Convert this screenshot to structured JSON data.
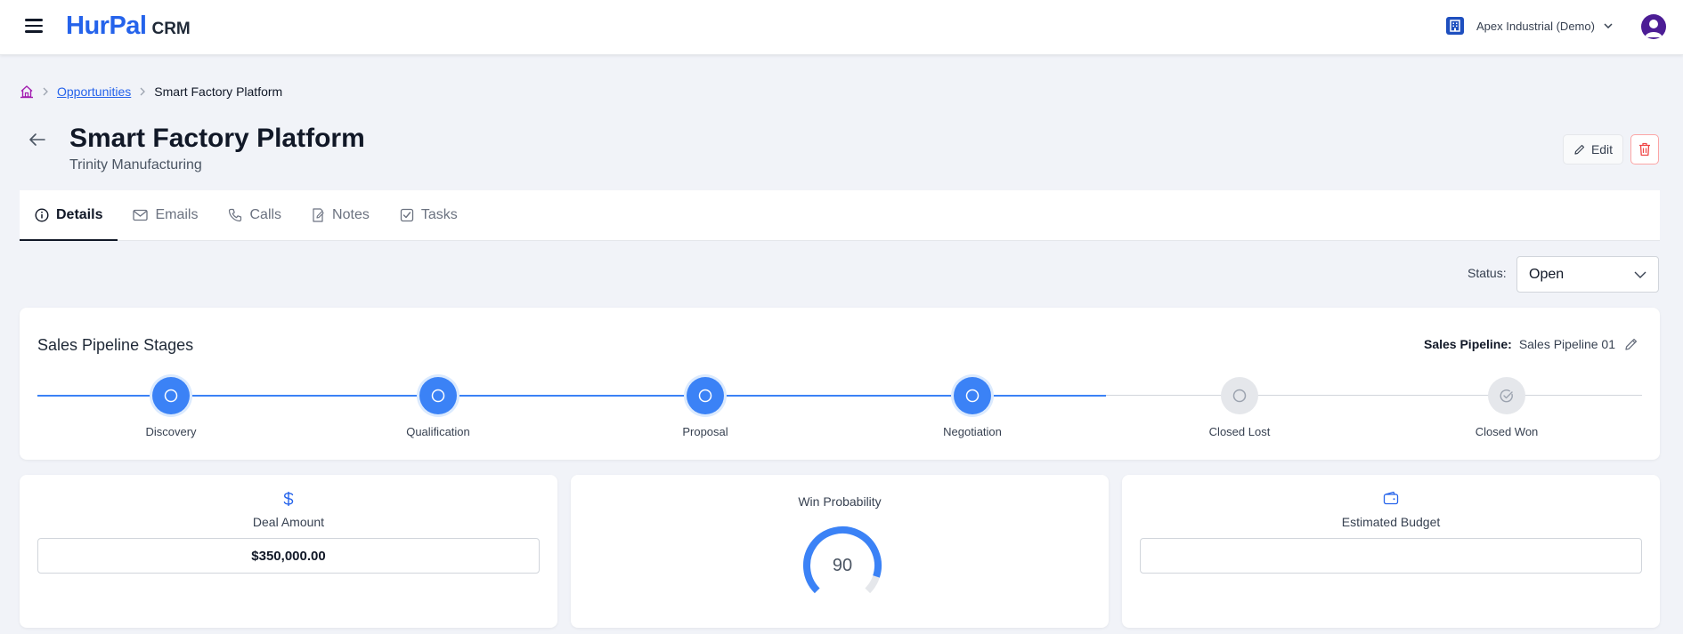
{
  "app": {
    "brand_main": "HurPal",
    "brand_sub": "CRM"
  },
  "header": {
    "org_name": "Apex Industrial (Demo)"
  },
  "breadcrumb": {
    "link": "Opportunities",
    "current": "Smart Factory Platform"
  },
  "page": {
    "title": "Smart Factory Platform",
    "subtitle": "Trinity Manufacturing",
    "edit_label": "Edit"
  },
  "tabs": [
    {
      "label": "Details",
      "icon": "info-icon",
      "active": true
    },
    {
      "label": "Emails",
      "icon": "mail-icon",
      "active": false
    },
    {
      "label": "Calls",
      "icon": "phone-icon",
      "active": false
    },
    {
      "label": "Notes",
      "icon": "note-icon",
      "active": false
    },
    {
      "label": "Tasks",
      "icon": "checkbox-icon",
      "active": false
    }
  ],
  "status": {
    "label": "Status:",
    "value": "Open"
  },
  "pipeline": {
    "title": "Sales Pipeline Stages",
    "pipeline_label": "Sales Pipeline:",
    "pipeline_value": "Sales Pipeline 01",
    "stages": [
      {
        "label": "Discovery",
        "done": true
      },
      {
        "label": "Qualification",
        "done": true
      },
      {
        "label": "Proposal",
        "done": true
      },
      {
        "label": "Negotiation",
        "done": true
      },
      {
        "label": "Closed Lost",
        "done": false
      },
      {
        "label": "Closed Won",
        "done": false
      }
    ]
  },
  "deal": {
    "label": "Deal Amount",
    "value": "$350,000.00"
  },
  "win": {
    "label": "Win Probability",
    "value": 90
  },
  "budget": {
    "label": "Estimated Budget",
    "value": ""
  },
  "colors": {
    "accent": "#3b82f6",
    "brand": "#2563eb",
    "danger": "#ef4444"
  }
}
